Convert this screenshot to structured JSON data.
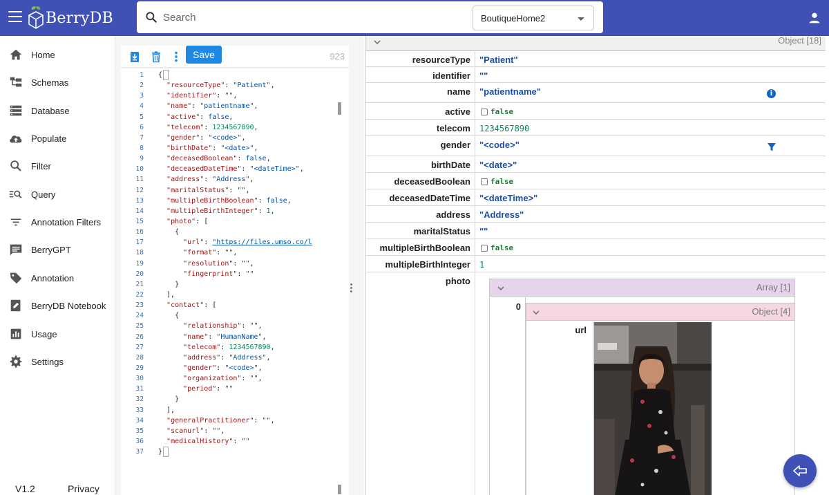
{
  "app": {
    "logo_text": "BerryDB"
  },
  "search": {
    "placeholder": "Search"
  },
  "database_select": {
    "value": "BoutiqueHome2"
  },
  "sidebar": {
    "items": [
      {
        "label": "Home",
        "icon": "home-icon"
      },
      {
        "label": "Schemas",
        "icon": "schema-icon"
      },
      {
        "label": "Database",
        "icon": "database-icon"
      },
      {
        "label": "Populate",
        "icon": "cloud-upload-icon"
      },
      {
        "label": "Filter",
        "icon": "search-icon"
      },
      {
        "label": "Query",
        "icon": "query-icon"
      },
      {
        "label": "Annotation Filters",
        "icon": "filter-list-icon"
      },
      {
        "label": "BerryGPT",
        "icon": "chat-icon"
      },
      {
        "label": "Annotation",
        "icon": "tag-icon"
      },
      {
        "label": "BerryDB Notebook",
        "icon": "notebook-icon"
      },
      {
        "label": "Usage",
        "icon": "bar-chart-icon"
      },
      {
        "label": "Settings",
        "icon": "gear-icon"
      }
    ],
    "footer": {
      "version": "V1.2",
      "privacy": "Privacy"
    }
  },
  "editor": {
    "save_label": "Save",
    "char_count": "923",
    "line_numbers": [
      "1",
      "2",
      "3",
      "4",
      "5",
      "6",
      "7",
      "8",
      "9",
      "10",
      "11",
      "12",
      "13",
      "14",
      "15",
      "16",
      "17",
      "18",
      "19",
      "20",
      "21",
      "22",
      "23",
      "24",
      "25",
      "26",
      "27",
      "28",
      "29",
      "30",
      "31",
      "32",
      "33",
      "34",
      "35",
      "36",
      "37"
    ],
    "lines": [
      "{",
      "  \"resourceType\": \"Patient\",",
      "  \"identifier\": \"\",",
      "  \"name\": \"patientname\",",
      "  \"active\": false,",
      "  \"telecom\": 1234567890,",
      "  \"gender\": \"<code>\",",
      "  \"birthDate\": \"<date>\",",
      "  \"deceasedBoolean\": false,",
      "  \"deceasedDateTime\": \"<dateTime>\",",
      "  \"address\": \"Address\",",
      "  \"maritalStatus\": \"\",",
      "  \"multipleBirthBoolean\": false,",
      "  \"multipleBirthInteger\": 1,",
      "  \"photo\": [",
      "    {",
      "      \"url\": \"https://files.umso.co/l",
      "      \"format\": \"\",",
      "      \"resolution\": \"\",",
      "      \"fingerprint\": \"\"",
      "    }",
      "  ],",
      "  \"contact\": [",
      "    {",
      "      \"relationship\": \"\",",
      "      \"name\": \"HumanName\",",
      "      \"telecom\": 1234567890,",
      "      \"address\": \"Address\",",
      "      \"gender\": \"<code>\",",
      "      \"organization\": \"\",",
      "      \"period\": \"\"",
      "    }",
      "  ],",
      "  \"generalPractitioner\": \"\",",
      "  \"scanurl\": \"\",",
      "  \"medicalHistory\": \"\"",
      "}"
    ]
  },
  "tree": {
    "root_label": "Object [18]",
    "rows": [
      {
        "key": "resourceType",
        "value": "\"Patient\"",
        "kind": "string"
      },
      {
        "key": "identifier",
        "value": "\"\"",
        "kind": "string"
      },
      {
        "key": "name",
        "value": "\"patientname\"",
        "kind": "string",
        "icon": "info-icon"
      },
      {
        "key": "active",
        "value": "false",
        "kind": "bool"
      },
      {
        "key": "telecom",
        "value": "1234567890",
        "kind": "number"
      },
      {
        "key": "gender",
        "value": "\"<code>\"",
        "kind": "string",
        "icon": "filter-icon"
      },
      {
        "key": "birthDate",
        "value": "\"<date>\"",
        "kind": "string"
      },
      {
        "key": "deceasedBoolean",
        "value": "false",
        "kind": "bool"
      },
      {
        "key": "deceasedDateTime",
        "value": "\"<dateTime>\"",
        "kind": "string"
      },
      {
        "key": "address",
        "value": "\"Address\"",
        "kind": "string"
      },
      {
        "key": "maritalStatus",
        "value": "\"\"",
        "kind": "string"
      },
      {
        "key": "multipleBirthBoolean",
        "value": "false",
        "kind": "bool"
      },
      {
        "key": "multipleBirthInteger",
        "value": "1",
        "kind": "number"
      }
    ],
    "photo": {
      "key": "photo",
      "array_label": "Array [1]",
      "index": "0",
      "object_label": "Object [4]",
      "url_key": "url"
    }
  },
  "colors": {
    "primary": "#3f51b5",
    "save_button": "#1e88e5",
    "string_value": "#1a4fa3",
    "number_value": "#098658",
    "json_key": "#a31515",
    "array_header": "#e6d3ec",
    "object_header": "#f6d7e4"
  }
}
